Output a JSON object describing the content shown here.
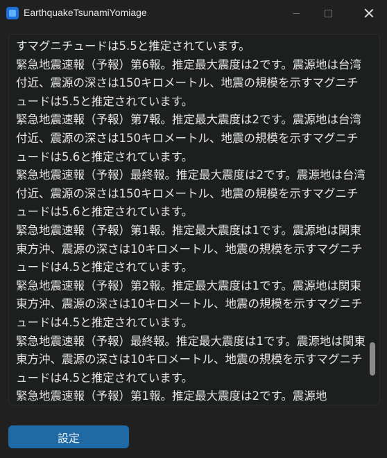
{
  "window": {
    "title": "EarthquakeTsunamiYomiage",
    "icon": "app-icon"
  },
  "log": {
    "text": "すマグニチュードは5.5と推定されています。\n緊急地震速報（予報）第6報。推定最大震度は2です。震源地は台湾付近、震源の深さは150キロメートル、地震の規模を示すマグニチュードは5.5と推定されています。\n緊急地震速報（予報）第7報。推定最大震度は2です。震源地は台湾付近、震源の深さは150キロメートル、地震の規模を示すマグニチュードは5.6と推定されています。\n緊急地震速報（予報）最終報。推定最大震度は2です。震源地は台湾付近、震源の深さは150キロメートル、地震の規模を示すマグニチュードは5.6と推定されています。\n緊急地震速報（予報）第1報。推定最大震度は1です。震源地は関東東方沖、震源の深さは10キロメートル、地震の規模を示すマグニチュードは4.5と推定されています。\n緊急地震速報（予報）第2報。推定最大震度は1です。震源地は関東東方沖、震源の深さは10キロメートル、地震の規模を示すマグニチュードは4.5と推定されています。\n緊急地震速報（予報）最終報。推定最大震度は1です。震源地は関東東方沖、震源の深さは10キロメートル、地震の規模を示すマグニチュードは4.5と推定されています。\n緊急地震速報（予報）第1報。推定最大震度は2です。震源地"
  },
  "buttons": {
    "settings_label": "設定"
  },
  "colors": {
    "background": "#202020",
    "accent": "#1f6aa5"
  }
}
